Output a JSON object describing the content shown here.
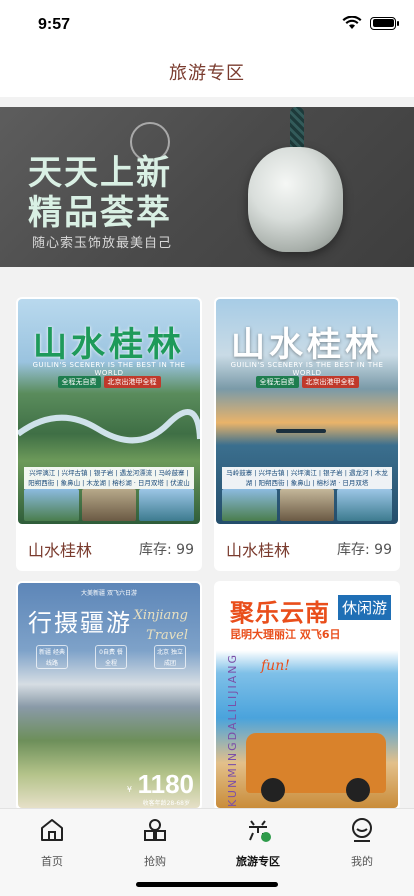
{
  "status_bar": {
    "time": "9:57"
  },
  "header": {
    "title": "旅游专区"
  },
  "banner": {
    "line1": "天天上新",
    "line2": "精品荟萃",
    "subtitle": "随心索玉饰放最美自己"
  },
  "products": [
    {
      "name": "山水桂林",
      "stock": "库存: 99",
      "poster": {
        "title": "山水桂林",
        "subtitle": "GUILIN'S SCENERY IS THE BEST IN THE WORLD",
        "tags": [
          "全程无自费",
          "北京出港甲全程"
        ],
        "routes": "兴坪漓江 | 兴坪古镇 | 银子岩 | 遇龙河漂流 | 马岭鼓寨 | 阳朔西街 | 象鼻山 | 木龙湖 | 榕杉湖 · 日月双塔 | 伏波山"
      }
    },
    {
      "name": "山水桂林",
      "stock": "库存: 99",
      "poster": {
        "title": "山水桂林",
        "subtitle": "GUILIN'S SCENERY IS THE BEST IN THE WORLD",
        "tags": [
          "全程无自费",
          "北京出港甲全程"
        ],
        "routes": "马岭鼓寨 | 兴坪古镇 | 兴坪漓江 | 银子岩 | 遇龙河 | 木龙湖 | 阳朔西街 | 象鼻山 | 榕杉湖 · 日月双塔"
      }
    },
    {
      "poster": {
        "top_text": "大美新疆 双飞六日游",
        "title": "行摄疆游",
        "en1": "Xinjiang",
        "en2": "Travel",
        "badges": [
          "新疆 经典线路",
          "0自费 餐 全程",
          "北京 独立成团"
        ],
        "yen": "¥",
        "price": "1180",
        "note": "收客年龄28-68岁"
      }
    },
    {
      "poster": {
        "title": "聚乐云南",
        "badge": "休闲游",
        "subtitle": "昆明大理丽江 双飞6日",
        "side_text": "KUNMINGDALILIJIANG",
        "fun": "fun!"
      }
    }
  ],
  "tabbar": {
    "items": [
      {
        "label": "首页",
        "icon": "home-icon",
        "active": false
      },
      {
        "label": "抢购",
        "icon": "shapes-icon",
        "active": false
      },
      {
        "label": "旅游专区",
        "icon": "exchange-icon",
        "active": true
      },
      {
        "label": "我的",
        "icon": "profile-icon",
        "active": false
      }
    ]
  }
}
